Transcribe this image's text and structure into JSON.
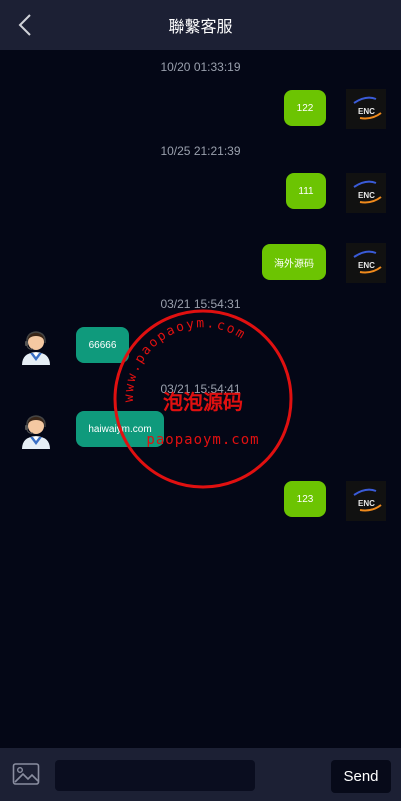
{
  "header": {
    "title": "聯繫客服"
  },
  "messages": [
    {
      "time": "10/20 01:33:19",
      "text": "122"
    },
    {
      "time": "10/25 21:21:39",
      "text": "111"
    },
    {
      "text": "海外源码"
    },
    {
      "time": "03/21 15:54:31",
      "text": "66666"
    },
    {
      "time": "03/21 15:54:41",
      "text": "haiwaiym.com"
    },
    {
      "text": "123"
    }
  ],
  "avatar_label": "ENC",
  "watermark": {
    "ring_text": "www.paopaoym.com",
    "center_text": "泡泡源码",
    "bottom_text": "paopaoym.com",
    "color": "#e01010"
  },
  "composer": {
    "placeholder": "",
    "send_label": "Send"
  },
  "colors": {
    "outgoing_bubble": "#6cc402",
    "incoming_bubble": "#0f9a7c",
    "header_bg": "#1c2034",
    "page_bg": "#040716"
  }
}
